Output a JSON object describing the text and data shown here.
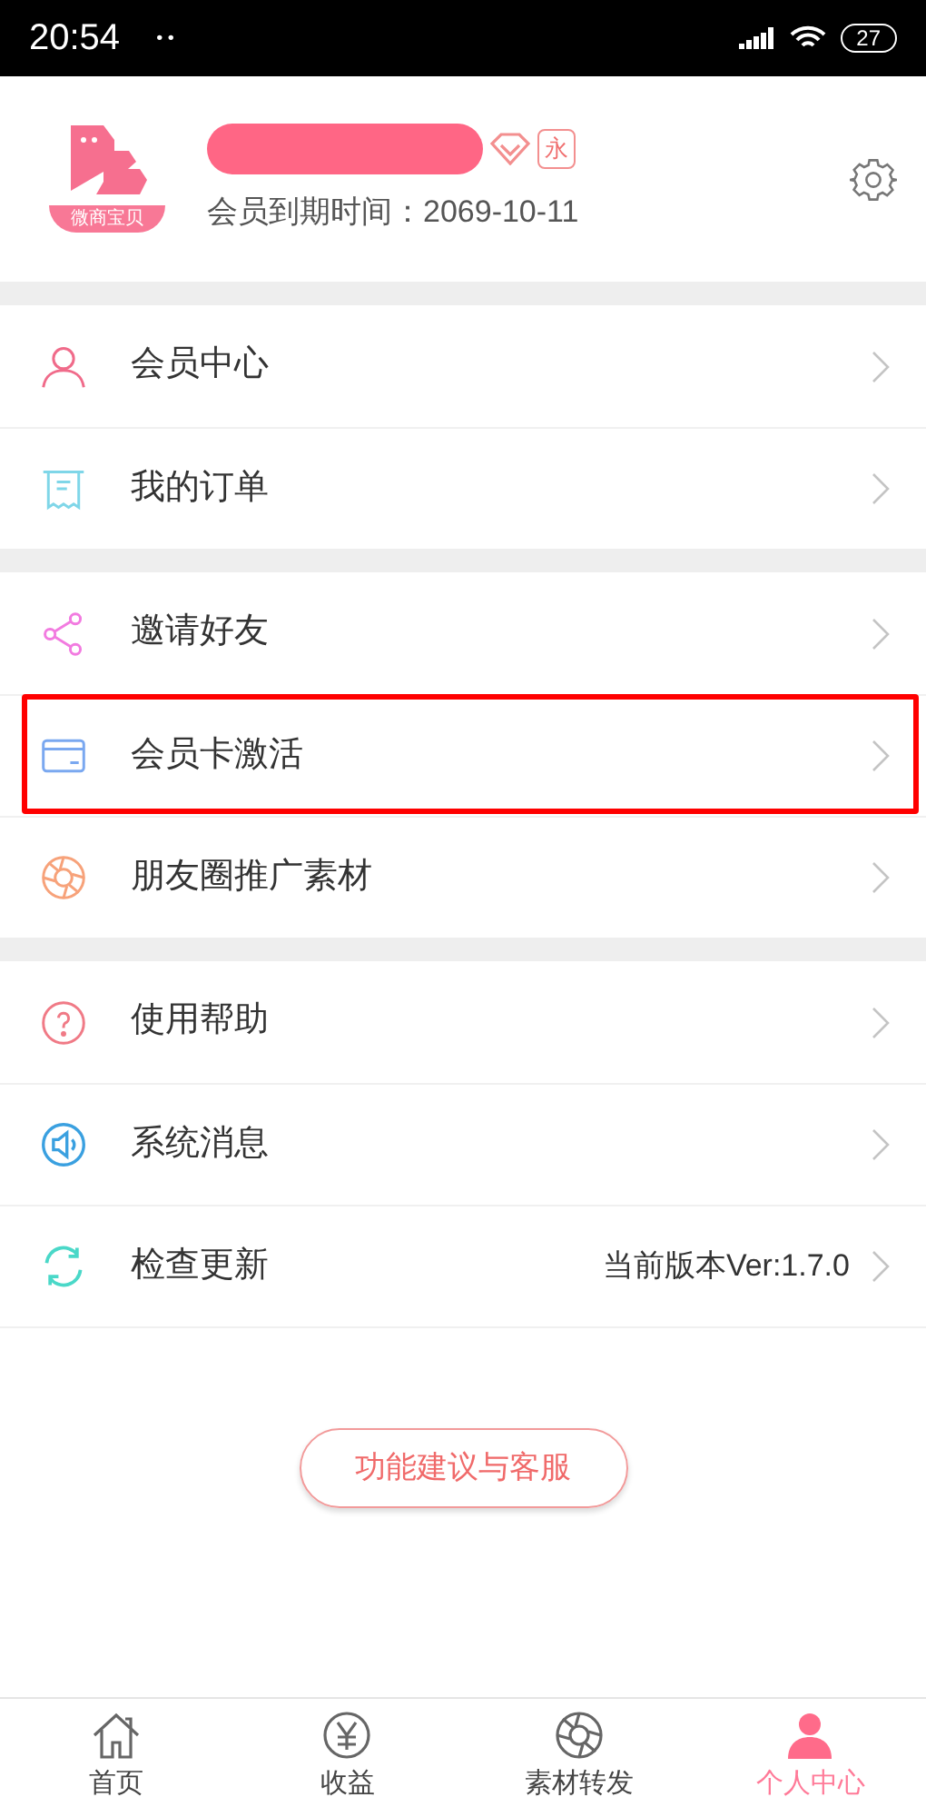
{
  "status_bar": {
    "time": "20:54",
    "dots": "• •",
    "battery": "27"
  },
  "profile": {
    "logo_text": "微商宝贝",
    "name_redacted": true,
    "badge": "永",
    "expiry": "会员到期时间：2069-10-11"
  },
  "menu_groups": [
    {
      "items": [
        {
          "label": "会员中心",
          "highlighted": false
        },
        {
          "label": "我的订单",
          "highlighted": false
        }
      ]
    },
    {
      "items": [
        {
          "label": "邀请好友",
          "highlighted": false
        },
        {
          "label": "会员卡激活",
          "highlighted": true
        },
        {
          "label": "朋友圈推广素材",
          "highlighted": false
        }
      ]
    },
    {
      "items": [
        {
          "label": "使用帮助",
          "highlighted": false
        },
        {
          "label": "系统消息",
          "highlighted": false
        },
        {
          "label": "检查更新",
          "value": "当前版本Ver:1.7.0",
          "highlighted": false
        }
      ]
    }
  ],
  "feedback_button": "功能建议与客服",
  "tabs": [
    {
      "label": "首页",
      "selected": false
    },
    {
      "label": "收益",
      "selected": false
    },
    {
      "label": "素材转发",
      "selected": false
    },
    {
      "label": "个人中心",
      "selected": true
    }
  ]
}
